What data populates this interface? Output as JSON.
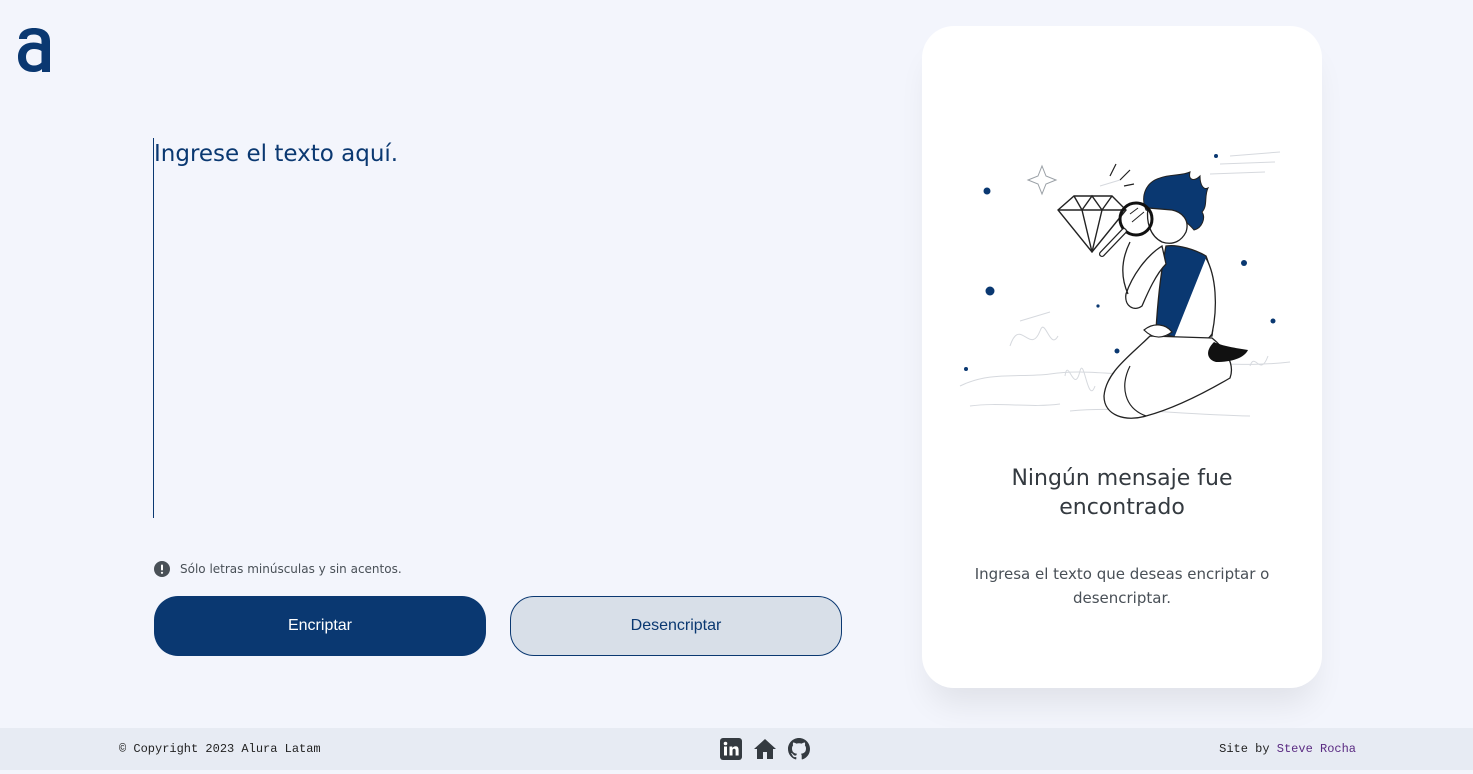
{
  "header": {
    "logo_icon": "alura-a-logo"
  },
  "editor": {
    "placeholder": "Ingrese el texto aquí."
  },
  "hint": {
    "icon": "exclamation-circle-icon",
    "text": "Sólo letras minúsculas y sin acentos."
  },
  "actions": {
    "encrypt_label": "Encriptar",
    "decrypt_label": "Desencriptar"
  },
  "output": {
    "illustration": "person-with-magnifying-glass",
    "title": "Ningún mensaje fue encontrado",
    "description": "Ingresa el texto que deseas encriptar o desencriptar."
  },
  "footer": {
    "copyright": "© Copyright 2023 Alura Latam",
    "social_icons": [
      "linkedin-icon",
      "home-icon",
      "github-icon"
    ],
    "credit_prefix": "Site by",
    "credit_name": "Steve Rocha"
  },
  "colors": {
    "primary": "#0a3871",
    "background": "#f3f5fc",
    "footer_bg": "#e7ebf3",
    "decrypt_bg": "#d8dfe8",
    "credit_link": "#5a2a82"
  }
}
